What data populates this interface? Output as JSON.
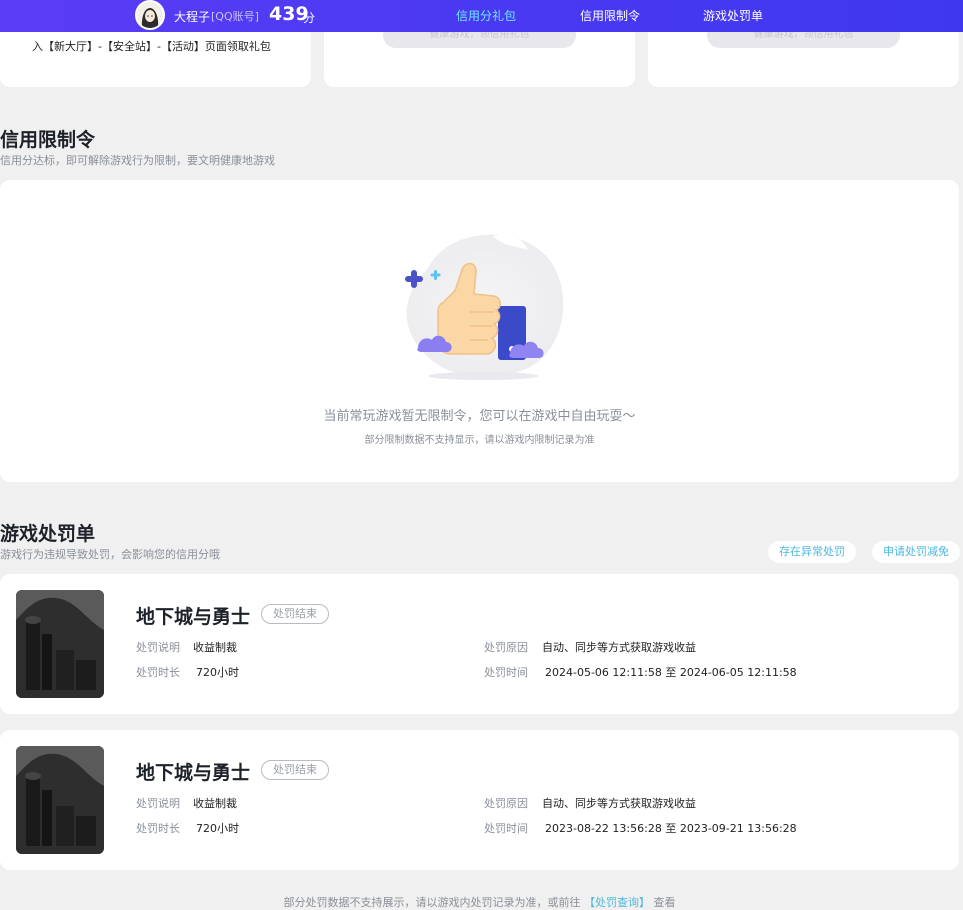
{
  "header": {
    "username": "大程子",
    "account_type": "[QQ账号]",
    "score": "439",
    "score_unit": "分",
    "nav": [
      {
        "label": "信用分礼包",
        "active": true
      },
      {
        "label": "信用限制令",
        "active": false
      },
      {
        "label": "游戏处罚单",
        "active": false
      }
    ]
  },
  "gift": {
    "card1_text": "入【新大厅】-【安全站】-【活动】页面领取礼包",
    "card2_button": "健康游戏，领信用礼包",
    "card3_button": "健康游戏，领信用礼包"
  },
  "restriction": {
    "title": "信用限制令",
    "subtitle": "信用分达标，即可解除游戏行为限制，要文明健康地游戏",
    "empty_main": "当前常玩游戏暂无限制令，您可以在游戏中自由玩耍～",
    "empty_sub": "部分限制数据不支持显示，请以游戏内限制记录为准"
  },
  "punishment": {
    "title": "游戏处罚单",
    "subtitle": "游戏行为违规导致处罚，会影响您的信用分哦",
    "btn_abnormal": "存在异常处罚",
    "btn_reduce": "申请处罚减免",
    "label_desc": "处罚说明",
    "label_duration": "处罚时长",
    "label_reason": "处罚原因",
    "label_time": "处罚时间",
    "items": [
      {
        "game": "地下城与勇士",
        "status": "处罚结束",
        "desc": "收益制裁",
        "duration": "720小时",
        "reason": "自动、同步等方式获取游戏收益",
        "time": "2024-05-06 12:11:58 至 2024-06-05 12:11:58"
      },
      {
        "game": "地下城与勇士",
        "status": "处罚结束",
        "desc": "收益制裁",
        "duration": "720小时",
        "reason": "自动、同步等方式获取游戏收益",
        "time": "2023-08-22 13:56:28 至 2023-09-21 13:56:28"
      }
    ]
  },
  "footer": {
    "note_before": "部分处罚数据不支持展示，请以游戏内处罚记录为准，或前往",
    "note_link": "【处罚查询】",
    "note_after": "查看"
  },
  "colors": {
    "topbar": "#4a39f2",
    "active_nav": "#6fe7ff",
    "link": "#4cb8dd",
    "background": "#f0f0f0"
  }
}
